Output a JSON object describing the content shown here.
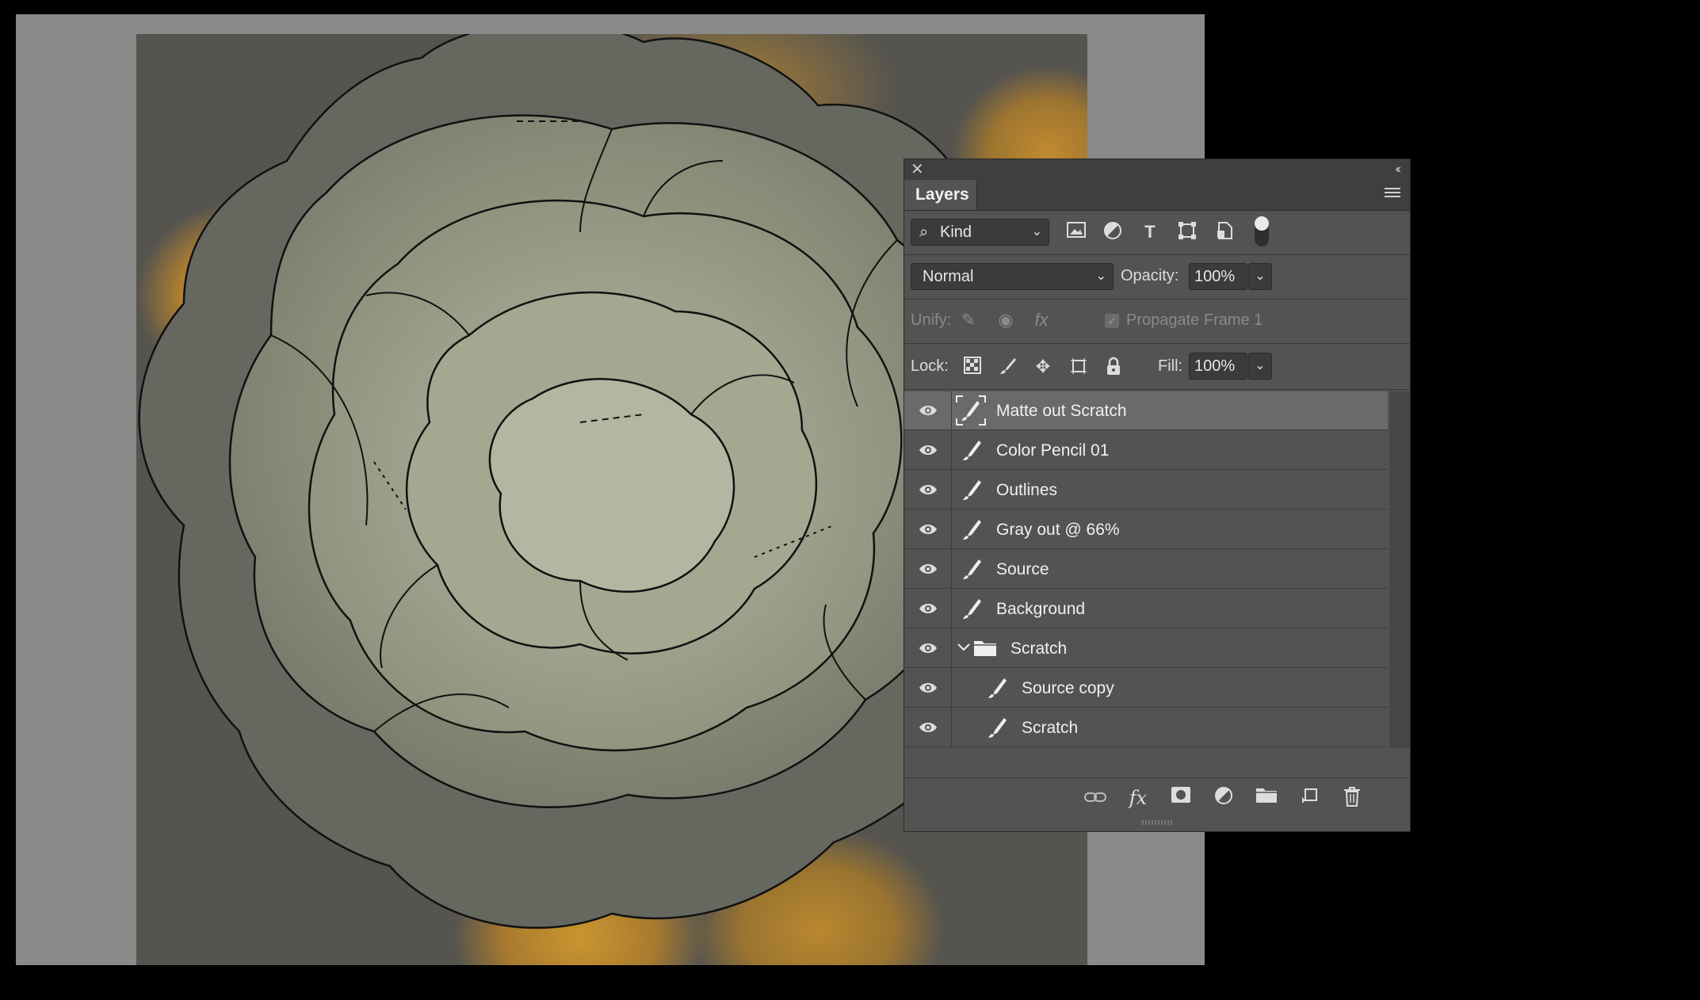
{
  "panel": {
    "tab_label": "Layers",
    "close_glyph": "✕",
    "collapse_glyph": "‹‹",
    "menu_icon": "hamburger-icon"
  },
  "filter": {
    "kind_label": "Kind",
    "icons": [
      "image-filter-icon",
      "adjustment-filter-icon",
      "type-filter-icon",
      "shape-filter-icon",
      "smart-object-filter-icon"
    ]
  },
  "blend": {
    "mode": "Normal",
    "opacity_label": "Opacity:",
    "opacity_value": "100%"
  },
  "unify": {
    "label": "Unify:",
    "propagate_label": "Propagate Frame 1"
  },
  "lock": {
    "label": "Lock:",
    "fill_label": "Fill:",
    "fill_value": "100%"
  },
  "layers": [
    {
      "name": "Matte out Scratch",
      "type": "paint-special",
      "selected": true
    },
    {
      "name": "Color Pencil 01",
      "type": "paint"
    },
    {
      "name": "Outlines",
      "type": "paint"
    },
    {
      "name": "Gray out @ 66%",
      "type": "paint"
    },
    {
      "name": "Source",
      "type": "paint"
    },
    {
      "name": "Background",
      "type": "paint"
    },
    {
      "name": "Scratch",
      "type": "group",
      "expanded": true
    },
    {
      "name": "Source copy",
      "type": "paint",
      "indent": 1
    },
    {
      "name": "Scratch",
      "type": "paint",
      "indent": 1
    }
  ],
  "bottom_icons": [
    "link-layers-icon",
    "fx-icon",
    "layer-mask-icon",
    "adjustment-layer-icon",
    "new-group-icon",
    "new-layer-icon",
    "delete-layer-icon"
  ],
  "colors": {
    "panel_bg": "#535353",
    "selected_row": "#6a6a6a",
    "canvas_gray": "#8a8a8a"
  }
}
